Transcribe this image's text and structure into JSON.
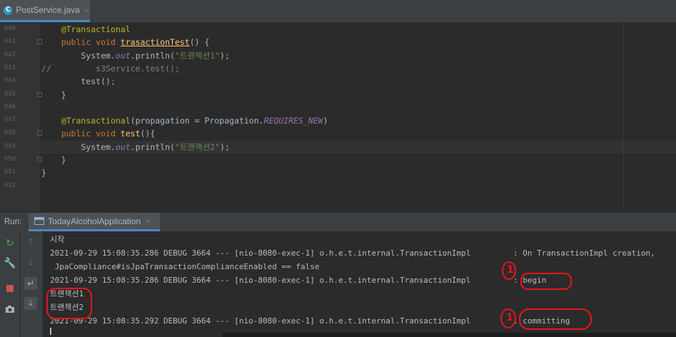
{
  "tab": {
    "label": "PostService.java",
    "close": "×",
    "icon": "C"
  },
  "editor": {
    "line_numbers": [
      "940",
      "941",
      "942",
      "943",
      "944",
      "945",
      "946",
      "947",
      "948",
      "949",
      "950",
      "951",
      "952"
    ],
    "lines": [
      [
        {
          "t": "    ",
          "c": ""
        },
        {
          "t": "@Transactional",
          "c": "ann"
        }
      ],
      [
        {
          "t": "    ",
          "c": ""
        },
        {
          "t": "public void ",
          "c": "kw"
        },
        {
          "t": "trasactionTest",
          "c": "fnu"
        },
        {
          "t": "() {",
          "c": ""
        }
      ],
      [
        {
          "t": "        System.",
          "c": ""
        },
        {
          "t": "out",
          "c": "fld"
        },
        {
          "t": ".println(",
          "c": ""
        },
        {
          "t": "\"트랜잭션1\"",
          "c": "str"
        },
        {
          "t": ");",
          "c": ""
        }
      ],
      [
        {
          "t": "//         s3Service.test();",
          "c": "cm"
        }
      ],
      [
        {
          "t": "        test()",
          "c": ""
        },
        {
          "t": ";",
          "c": "kw"
        }
      ],
      [
        {
          "t": "    }",
          "c": ""
        }
      ],
      [
        {
          "t": "",
          "c": ""
        }
      ],
      [
        {
          "t": "    ",
          "c": ""
        },
        {
          "t": "@Transactional",
          "c": "ann"
        },
        {
          "t": "(propagation = Propagation.",
          "c": ""
        },
        {
          "t": "REQUIRES_NEW",
          "c": "const"
        },
        {
          "t": ")",
          "c": ""
        }
      ],
      [
        {
          "t": "    ",
          "c": ""
        },
        {
          "t": "public void ",
          "c": "kw"
        },
        {
          "t": "test",
          "c": "fn"
        },
        {
          "t": "(){",
          "c": ""
        }
      ],
      [
        {
          "t": "        System.",
          "c": ""
        },
        {
          "t": "out",
          "c": "fld"
        },
        {
          "t": ".println(",
          "c": ""
        },
        {
          "t": "\"트랜잭션2\"",
          "c": "str"
        },
        {
          "t": ");",
          "c": ""
        }
      ],
      [
        {
          "t": "    }",
          "c": ""
        }
      ],
      [
        {
          "t": "}",
          "c": ""
        }
      ],
      [
        {
          "t": "",
          "c": ""
        }
      ]
    ]
  },
  "run": {
    "label": "Run:",
    "tab_label": "TodayAlcoholApplication",
    "tab_close": "×"
  },
  "console": {
    "lines": [
      "시작",
      "2021-09-29 15:08:35.286 DEBUG 3664 --- [nio-8080-exec-1] o.h.e.t.internal.TransactionImpl         : On TransactionImpl creation,",
      " JpaCompliance#isJpaTransactionComplianceEnabled == false",
      "2021-09-29 15:08:35.286 DEBUG 3664 --- [nio-8080-exec-1] o.h.e.t.internal.TransactionImpl         : begin",
      "트랜잭션1",
      "트랜잭션2",
      "2021-09-29 15:08:35.292 DEBUG 3664 --- [nio-8080-exec-1] o.h.e.t.internal.TransactionImpl         : committing"
    ]
  },
  "annotations": {
    "mark1": "1",
    "mark2": "1"
  },
  "colors": {
    "accent": "#4a88c7",
    "annotation_red": "#e8141e",
    "run_green": "#499c54",
    "stop_red": "#c75450"
  },
  "icons": [
    "class-icon",
    "close-icon",
    "app-icon",
    "rerun-icon",
    "wrench-icon",
    "stop-icon",
    "camera-icon",
    "up-arrow-icon",
    "down-arrow-icon",
    "soft-wrap-icon",
    "scroll-to-end-icon"
  ]
}
